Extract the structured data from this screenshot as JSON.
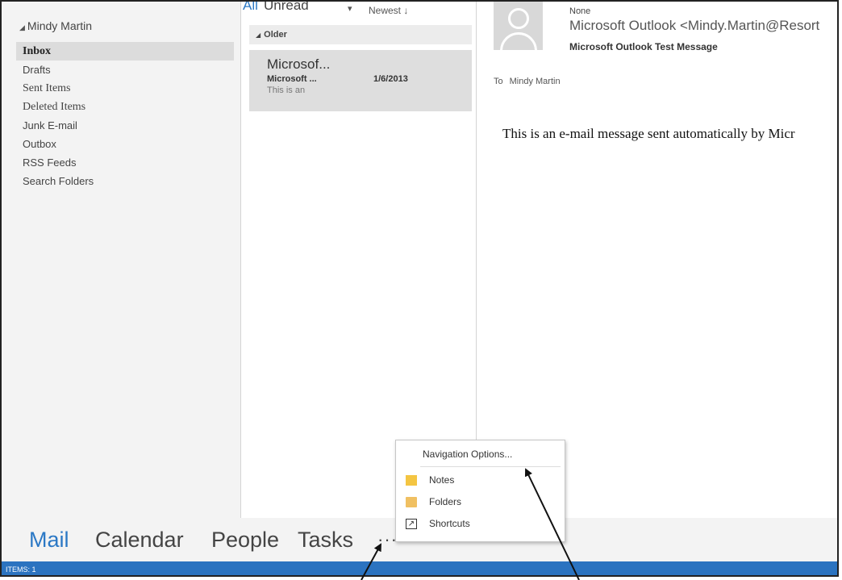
{
  "folder_pane": {
    "account": "Mindy Martin",
    "folders": [
      "Inbox",
      "Drafts",
      "Sent Items",
      "Deleted Items",
      "Junk E-mail",
      "Outbox",
      "RSS Feeds",
      "Search Folders"
    ]
  },
  "message_list": {
    "filter_all": "All",
    "filter_unread": "Unread",
    "sort": "Newest",
    "group": "Older",
    "item": {
      "sender": "Microsof...",
      "from_line": "Microsoft ...",
      "date": "1/6/2013",
      "preview": "This is an"
    }
  },
  "reading_pane": {
    "importance": "None",
    "from": "Microsoft Outlook <Mindy.Martin@Resort",
    "subject": "Microsoft Outlook Test Message",
    "to_label": "To",
    "to_name": "Mindy Martin",
    "body": "This is an e-mail message sent automatically by Micr"
  },
  "nav_bar": {
    "items": [
      "Mail",
      "Calendar",
      "People",
      "Tasks"
    ],
    "more": "···"
  },
  "popup_menu": {
    "navigation_options": "Navigation Options...",
    "items": [
      "Notes",
      "Folders",
      "Shortcuts"
    ]
  },
  "status_bar": {
    "text": "ITEMS: 1"
  },
  "colors": {
    "accent": "#2b78c5",
    "status_bar": "#2b73c0"
  }
}
